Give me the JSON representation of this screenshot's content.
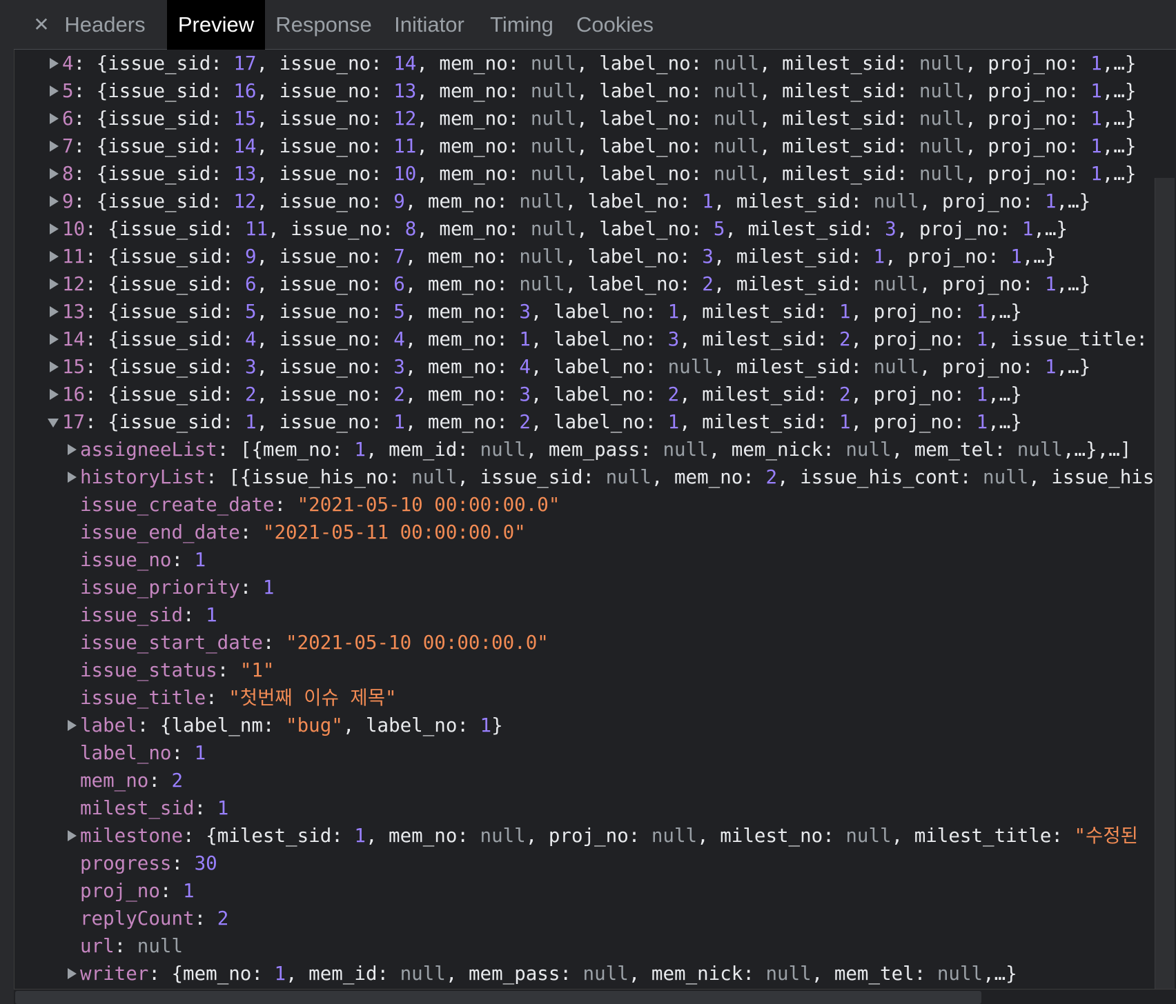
{
  "tabs": [
    {
      "label": "Headers",
      "active": false
    },
    {
      "label": "Preview",
      "active": true
    },
    {
      "label": "Response",
      "active": false
    },
    {
      "label": "Initiator",
      "active": false
    },
    {
      "label": "Timing",
      "active": false
    },
    {
      "label": "Cookies",
      "active": false
    }
  ],
  "close_icon": "close-icon",
  "colors": {
    "key": "#c586c0",
    "number": "#9980ff",
    "string": "#f28b54",
    "null": "#9aa0a6",
    "text": "#e8eaed",
    "background": "#202124",
    "active_tab": "#000000"
  },
  "rows": [
    {
      "arrow": "collapsed",
      "key": "4",
      "value": "{issue_sid: 17, issue_no: 14, mem_no: null, label_no: null, milest_sid: null, proj_no: 1,…}"
    },
    {
      "arrow": "collapsed",
      "key": "5",
      "value": "{issue_sid: 16, issue_no: 13, mem_no: null, label_no: null, milest_sid: null, proj_no: 1,…}"
    },
    {
      "arrow": "collapsed",
      "key": "6",
      "value": "{issue_sid: 15, issue_no: 12, mem_no: null, label_no: null, milest_sid: null, proj_no: 1,…}"
    },
    {
      "arrow": "collapsed",
      "key": "7",
      "value": "{issue_sid: 14, issue_no: 11, mem_no: null, label_no: null, milest_sid: null, proj_no: 1,…}"
    },
    {
      "arrow": "collapsed",
      "key": "8",
      "value": "{issue_sid: 13, issue_no: 10, mem_no: null, label_no: null, milest_sid: null, proj_no: 1,…}"
    },
    {
      "arrow": "collapsed",
      "key": "9",
      "value": "{issue_sid: 12, issue_no: 9, mem_no: null, label_no: 1, milest_sid: null, proj_no: 1,…}"
    },
    {
      "arrow": "collapsed",
      "key": "10",
      "value": "{issue_sid: 11, issue_no: 8, mem_no: null, label_no: 5, milest_sid: 3, proj_no: 1,…}"
    },
    {
      "arrow": "collapsed",
      "key": "11",
      "value": "{issue_sid: 9, issue_no: 7, mem_no: null, label_no: 3, milest_sid: 1, proj_no: 1,…}"
    },
    {
      "arrow": "collapsed",
      "key": "12",
      "value": "{issue_sid: 6, issue_no: 6, mem_no: null, label_no: 2, milest_sid: null, proj_no: 1,…}"
    },
    {
      "arrow": "collapsed",
      "key": "13",
      "value": "{issue_sid: 5, issue_no: 5, mem_no: 3, label_no: 1, milest_sid: 1, proj_no: 1,…}"
    },
    {
      "arrow": "collapsed",
      "key": "14",
      "value": "{issue_sid: 4, issue_no: 4, mem_no: 1, label_no: 3, milest_sid: 2, proj_no: 1, issue_title:"
    },
    {
      "arrow": "collapsed",
      "key": "15",
      "value": "{issue_sid: 3, issue_no: 3, mem_no: 4, label_no: null, milest_sid: null, proj_no: 1,…}"
    },
    {
      "arrow": "collapsed",
      "key": "16",
      "value": "{issue_sid: 2, issue_no: 2, mem_no: 3, label_no: 2, milest_sid: 2, proj_no: 1,…}"
    },
    {
      "arrow": "expanded",
      "key": "17",
      "value": "{issue_sid: 1, issue_no: 1, mem_no: 2, label_no: 1, milest_sid: 1, proj_no: 1,…}"
    }
  ],
  "properties": [
    {
      "arrow": "collapsed",
      "key": "assigneeList",
      "value": "[{mem_no: 1, mem_id: null, mem_pass: null, mem_nick: null, mem_tel: null,…},…]",
      "type": "object"
    },
    {
      "arrow": "collapsed",
      "key": "historyList",
      "value": "[{issue_his_no: null, issue_sid: null, mem_no: 2, issue_his_cont: null, issue_his",
      "type": "object"
    },
    {
      "arrow": "none",
      "key": "issue_create_date",
      "value": "\"2021-05-10 00:00:00.0\"",
      "type": "string"
    },
    {
      "arrow": "none",
      "key": "issue_end_date",
      "value": "\"2021-05-11 00:00:00.0\"",
      "type": "string"
    },
    {
      "arrow": "none",
      "key": "issue_no",
      "value": "1",
      "type": "number"
    },
    {
      "arrow": "none",
      "key": "issue_priority",
      "value": "1",
      "type": "number"
    },
    {
      "arrow": "none",
      "key": "issue_sid",
      "value": "1",
      "type": "number"
    },
    {
      "arrow": "none",
      "key": "issue_start_date",
      "value": "\"2021-05-10 00:00:00.0\"",
      "type": "string"
    },
    {
      "arrow": "none",
      "key": "issue_status",
      "value": "\"1\"",
      "type": "string"
    },
    {
      "arrow": "none",
      "key": "issue_title",
      "value": "\"첫번째 이슈 제목\"",
      "type": "string"
    },
    {
      "arrow": "collapsed",
      "key": "label",
      "value": "{label_nm: \"bug\", label_no: 1}",
      "type": "object"
    },
    {
      "arrow": "none",
      "key": "label_no",
      "value": "1",
      "type": "number"
    },
    {
      "arrow": "none",
      "key": "mem_no",
      "value": "2",
      "type": "number"
    },
    {
      "arrow": "none",
      "key": "milest_sid",
      "value": "1",
      "type": "number"
    },
    {
      "arrow": "collapsed",
      "key": "milestone",
      "value": "{milest_sid: 1, mem_no: null, proj_no: null, milest_no: null, milest_title: \"수정된 ",
      "type": "object"
    },
    {
      "arrow": "none",
      "key": "progress",
      "value": "30",
      "type": "number"
    },
    {
      "arrow": "none",
      "key": "proj_no",
      "value": "1",
      "type": "number"
    },
    {
      "arrow": "none",
      "key": "replyCount",
      "value": "2",
      "type": "number"
    },
    {
      "arrow": "none",
      "key": "url",
      "value": "null",
      "type": "null"
    },
    {
      "arrow": "collapsed",
      "key": "writer",
      "value": "{mem_no: 1, mem_id: null, mem_pass: null, mem_nick: null, mem_tel: null,…}",
      "type": "object"
    }
  ]
}
